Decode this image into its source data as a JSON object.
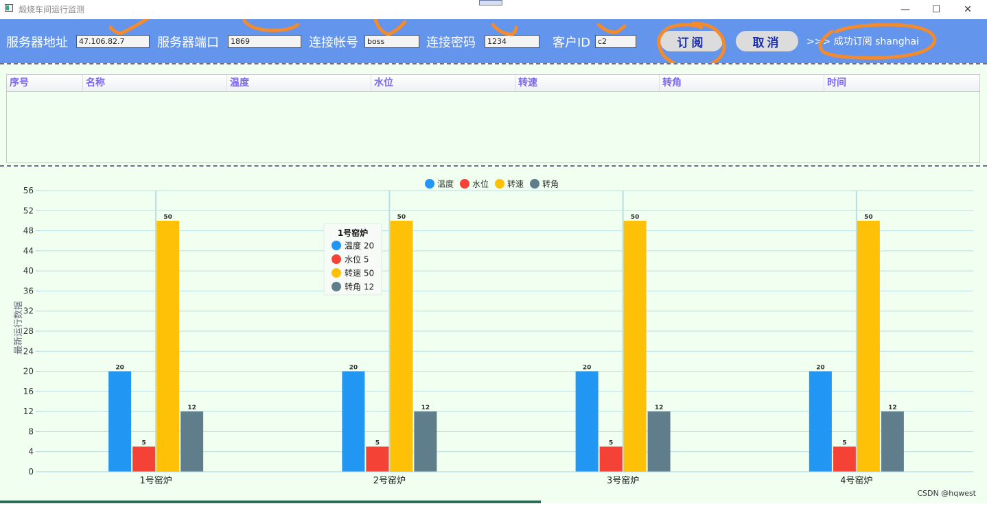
{
  "window": {
    "title": "煅烧车间运行监测",
    "controls": {
      "minimize": "—",
      "maximize": "☐",
      "close": "✕"
    }
  },
  "toolbar": {
    "server_address_label": "服务器地址",
    "server_address_value": "47.106.82.7",
    "server_port_label": "服务器端口",
    "server_port_value": "1869",
    "account_label": "连接帐号",
    "account_value": "boss",
    "password_label": "连接密码",
    "password_value": "1234",
    "client_id_label": "客户ID",
    "client_id_value": "c2",
    "subscribe_label": "订阅",
    "cancel_label": "取消",
    "status_text": ">>> 成功订阅 shanghai"
  },
  "table": {
    "columns": [
      "序号",
      "名称",
      "温度",
      "水位",
      "转速",
      "转角",
      "时间"
    ],
    "rows": []
  },
  "chart_data": {
    "type": "bar",
    "categories": [
      "1号窑炉",
      "2号窑炉",
      "3号窑炉",
      "4号窑炉"
    ],
    "series": [
      {
        "name": "温度",
        "color": "#2196f3",
        "values": [
          20,
          20,
          20,
          20
        ]
      },
      {
        "name": "水位",
        "color": "#f44336",
        "values": [
          5,
          5,
          5,
          5
        ]
      },
      {
        "name": "转速",
        "color": "#ffc107",
        "values": [
          50,
          50,
          50,
          50
        ]
      },
      {
        "name": "转角",
        "color": "#607d8b",
        "values": [
          12,
          12,
          12,
          12
        ]
      }
    ],
    "ylabel": "最新运行数据",
    "ylim": [
      0,
      56
    ],
    "yticks": [
      0,
      4,
      8,
      12,
      16,
      20,
      24,
      28,
      32,
      36,
      40,
      44,
      48,
      52,
      56
    ],
    "grid": true,
    "legend": "top-center",
    "tooltip": {
      "title": "1号窑炉",
      "items": [
        {
          "name": "温度",
          "value": "20"
        },
        {
          "name": "水位",
          "value": "5"
        },
        {
          "name": "转速",
          "value": "50"
        },
        {
          "name": "转角",
          "value": "12"
        }
      ]
    }
  },
  "watermark": "CSDN @hqwest"
}
